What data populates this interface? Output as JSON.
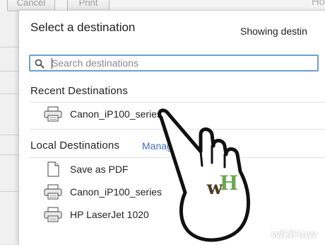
{
  "background": {
    "cancel_label": "Cancel",
    "print_label": "Print",
    "corner_text": "Ho"
  },
  "dialog": {
    "title": "Select a destination",
    "showing_text": "Showing destin",
    "search": {
      "placeholder": "Search destinations",
      "value": ""
    },
    "recent": {
      "heading": "Recent Destinations",
      "items": [
        {
          "label": "Canon_iP100_series",
          "icon": "printer-icon"
        }
      ]
    },
    "local": {
      "heading": "Local Destinations",
      "manage_label": "Manage",
      "items": [
        {
          "label": "Save as PDF",
          "icon": "document-icon"
        },
        {
          "label": "Canon_iP100_series",
          "icon": "printer-icon"
        },
        {
          "label": "HP LaserJet 1020",
          "icon": "printer-icon"
        }
      ]
    }
  },
  "watermark": {
    "badge": "wH",
    "site_prefix": "wiki",
    "site_suffix": "How"
  },
  "colors": {
    "search_border": "#6d9ed8",
    "link": "#3b6fc1",
    "badge_green": "#6aa84f",
    "badge_brown": "#4a3b22"
  }
}
